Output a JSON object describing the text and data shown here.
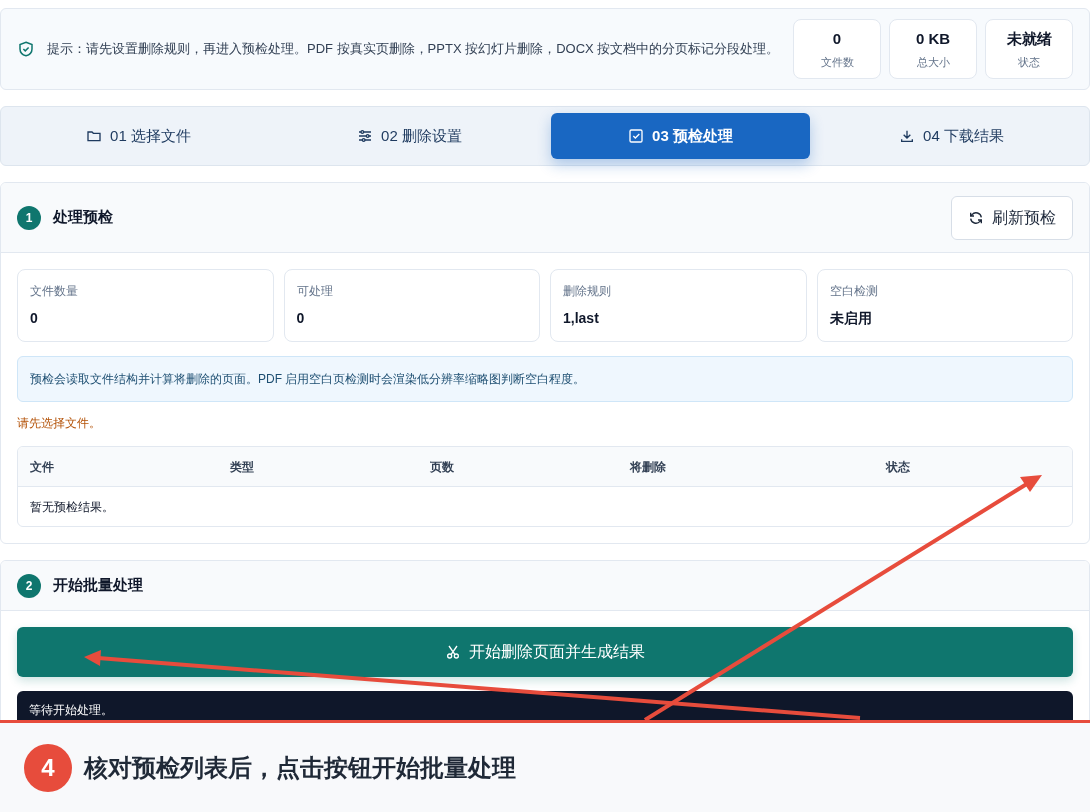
{
  "notice": {
    "text": "提示：请先设置删除规则，再进入预检处理。PDF 按真实页删除，PPTX 按幻灯片删除，DOCX 按文档中的分页标记分段处理。"
  },
  "stats": [
    {
      "value": "0",
      "label": "文件数"
    },
    {
      "value": "0 KB",
      "label": "总大小"
    },
    {
      "value": "未就绪",
      "label": "状态"
    }
  ],
  "steps": [
    {
      "label": "01 选择文件",
      "kind": "folder",
      "selected": false
    },
    {
      "label": "02 删除设置",
      "kind": "sliders",
      "selected": false
    },
    {
      "label": "03 预检处理",
      "kind": "check",
      "selected": true
    },
    {
      "label": "04 下载结果",
      "kind": "download",
      "selected": false
    }
  ],
  "precheck": {
    "number": "1",
    "title": "处理预检",
    "refresh_button": "刷新预检",
    "metrics": [
      {
        "label": "文件数量",
        "value": "0"
      },
      {
        "label": "可处理",
        "value": "0"
      },
      {
        "label": "删除规则",
        "value": "1,last"
      },
      {
        "label": "空白检测",
        "value": "未启用"
      }
    ],
    "info": "预检会读取文件结构并计算将删除的页面。PDF 启用空白页检测时会渲染低分辨率缩略图判断空白程度。",
    "warning": "请先选择文件。",
    "table": {
      "columns": [
        "文件",
        "类型",
        "页数",
        "将删除",
        "状态"
      ],
      "empty": "暂无预检结果。"
    }
  },
  "process": {
    "number": "2",
    "title": "开始批量处理",
    "start_button": "开始删除页面并生成结果",
    "log": "等待开始处理。"
  },
  "caption": {
    "number": "4",
    "text": "核对预检列表后，点击按钮开始批量处理"
  }
}
